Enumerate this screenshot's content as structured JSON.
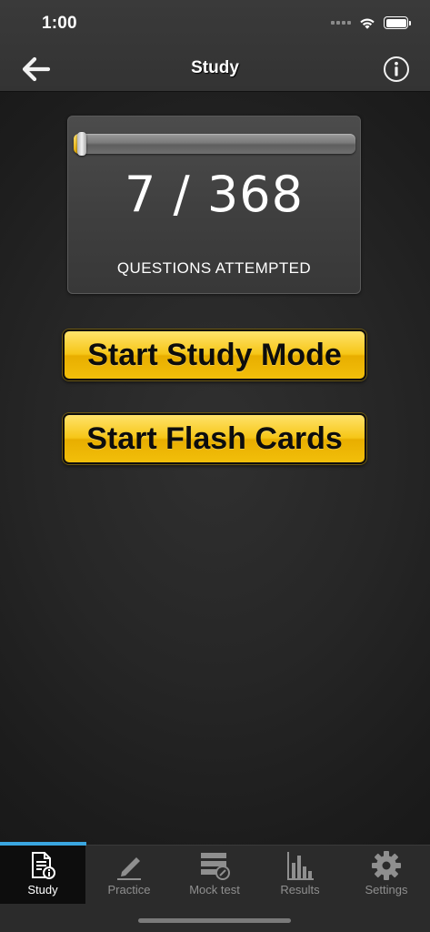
{
  "status_bar": {
    "time": "1:00"
  },
  "nav": {
    "title": "Study",
    "back_icon": "back-arrow-icon",
    "info_icon": "info-icon"
  },
  "progress": {
    "attempted": "7",
    "separator": "/",
    "total": "368",
    "attempted_fraction": 0.019,
    "label": "QUESTIONS ATTEMPTED"
  },
  "actions": {
    "study_mode": "Start Study Mode",
    "flash_cards": "Start Flash Cards"
  },
  "tabs": [
    {
      "label": "Study",
      "icon": "study-document-icon",
      "active": true
    },
    {
      "label": "Practice",
      "icon": "pencil-icon",
      "active": false
    },
    {
      "label": "Mock test",
      "icon": "mock-test-icon",
      "active": false
    },
    {
      "label": "Results",
      "icon": "bar-chart-icon",
      "active": false
    },
    {
      "label": "Settings",
      "icon": "gear-icon",
      "active": false
    }
  ],
  "colors": {
    "accent": "#f6c617",
    "tab_indicator": "#3aa6e0",
    "background": "#262626"
  }
}
